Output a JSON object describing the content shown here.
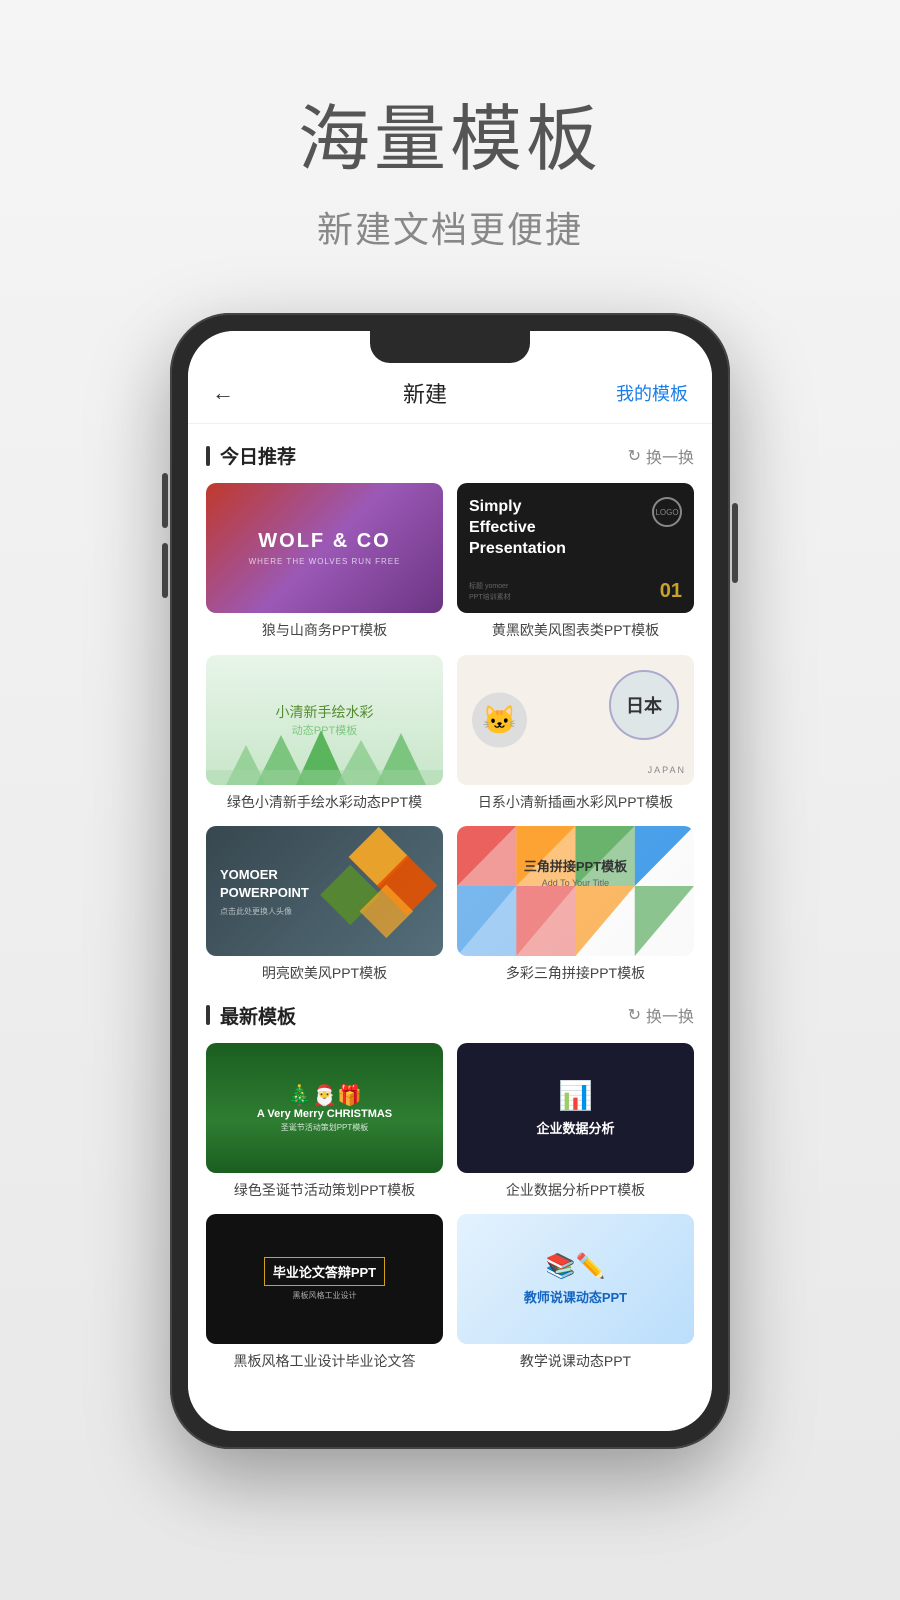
{
  "page": {
    "bg_title": "海量模板",
    "bg_subtitle": "新建文档更便捷"
  },
  "nav": {
    "back_icon": "←",
    "title": "新建",
    "action": "我的模板"
  },
  "sections": [
    {
      "id": "today",
      "title": "今日推荐",
      "action": "换一换",
      "templates": [
        {
          "id": "wolf",
          "name": "狼与山商务PPT模板",
          "thumb_type": "wolf"
        },
        {
          "id": "simply",
          "name": "黄黑欧美风图表类PPT模板",
          "thumb_type": "simply"
        },
        {
          "id": "watercolor",
          "name": "绿色小清新手绘水彩动态PPT模",
          "thumb_type": "watercolor"
        },
        {
          "id": "japan",
          "name": "日系小清新插画水彩风PPT模板",
          "thumb_type": "japan"
        },
        {
          "id": "yomoer",
          "name": "明亮欧美风PPT模板",
          "thumb_type": "yomoer"
        },
        {
          "id": "triangle",
          "name": "多彩三角拼接PPT模板",
          "thumb_type": "triangle"
        }
      ]
    },
    {
      "id": "latest",
      "title": "最新模板",
      "action": "换一换",
      "templates": [
        {
          "id": "christmas",
          "name": "绿色圣诞节活动策划PPT模板",
          "thumb_type": "christmas"
        },
        {
          "id": "bizdata",
          "name": "企业数据分析PPT模板",
          "thumb_type": "bizdata"
        },
        {
          "id": "graduation",
          "name": "黑板风格工业设计毕业论文答",
          "thumb_type": "graduation"
        },
        {
          "id": "teacher",
          "name": "教学说课动态PPT",
          "thumb_type": "teacher"
        }
      ]
    }
  ],
  "labels": {
    "wolf_line1": "WOLF & CO",
    "wolf_line2": "WHERE THE WOLVES RUN FREE",
    "simply_line1": "Simply",
    "simply_line2": "Effective",
    "simply_line3": "Presentation",
    "simply_logo": "LOGO",
    "simply_meta1": "标题 yomoer",
    "simply_meta2": "PPT培训素材",
    "simply_num": "01",
    "wc_title": "小清新手绘水彩",
    "wc_sub": "动态PPT模板",
    "japan_text": "日本",
    "japan_label": "JAPAN",
    "yomoer_title": "YOMOER",
    "yomoer_line2": "POWERPOINT",
    "yomoer_sub": "点击此处更换人头像",
    "triangle_title": "三角拼接PPT模板",
    "triangle_sub": "Add To Your Title",
    "xmas_title": "A Very Merry CHRISTMAS",
    "xmas_sub": "圣诞节活动策划PPT模板",
    "bizdata_text": "企业数据分析",
    "grad_title": "毕业论文答辩PPT",
    "teacher_text": "教师说课动态PPT"
  }
}
